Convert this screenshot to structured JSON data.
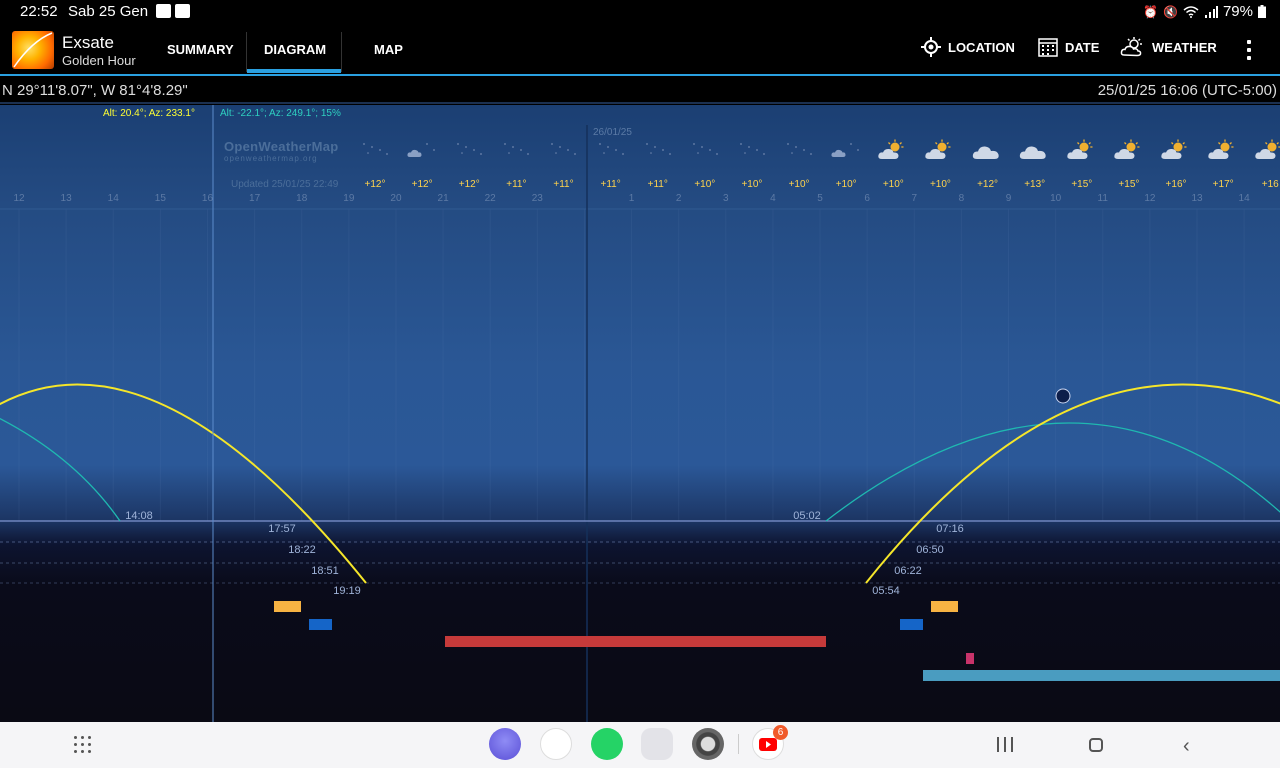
{
  "status_bar": {
    "time": "22:52",
    "date": "Sab 25 Gen",
    "battery": "79%"
  },
  "app": {
    "name": "Exsate",
    "subtitle": "Golden Hour"
  },
  "tabs": [
    {
      "label": "SUMMARY",
      "active": false
    },
    {
      "label": "DIAGRAM",
      "active": true
    },
    {
      "label": "MAP",
      "active": false
    }
  ],
  "actions": {
    "location": "LOCATION",
    "date": "DATE",
    "weather": "WEATHER"
  },
  "coords": {
    "position": "N 29°11'8.07\", W 81°4'8.29\"",
    "datetime": "25/01/25 16:06 (UTC-5:00)"
  },
  "diagram": {
    "sun_readout": "Alt: 20.4°; Az: 233.1°",
    "moon_readout": "Alt: -22.1°; Az: 249.1°; 15%",
    "provider": "OpenWeatherMap",
    "provider_url": "openweathermap.org",
    "updated": "Updated 25/01/25 22:49",
    "next_date": "26/01/25",
    "hours": [
      "12",
      "13",
      "14",
      "15",
      "16",
      "17",
      "18",
      "19",
      "20",
      "21",
      "22",
      "23",
      "",
      "1",
      "2",
      "3",
      "4",
      "5",
      "6",
      "7",
      "8",
      "9",
      "10",
      "11",
      "12",
      "13",
      "14"
    ],
    "temps": [
      "+12°",
      "+12°",
      "+12°",
      "+11°",
      "+11°",
      "+11°",
      "+11°",
      "+10°",
      "+10°",
      "+10°",
      "+10°",
      "+10°",
      "+10°",
      "+12°",
      "+13°",
      "+15°",
      "+15°",
      "+16°",
      "+17°",
      "+16"
    ],
    "weather_icons": [
      "night-clear-icon",
      "night-cloud-icon",
      "night-clear-icon",
      "night-clear-icon",
      "night-clear-icon",
      "night-clear-icon",
      "night-clear-icon",
      "night-clear-icon",
      "night-clear-icon",
      "night-clear-icon",
      "night-cloud-icon",
      "sun-cloud-icon",
      "sun-cloud-icon",
      "cloud-icon",
      "cloud-icon",
      "sun-cloud-icon",
      "sun-cloud-icon",
      "sun-cloud-icon",
      "sun-cloud-icon",
      "sun-cloud-icon"
    ],
    "times": {
      "moonset": "14:08",
      "golden_end": "17:57",
      "sunset_civil": "18:22",
      "nautical": "18:51",
      "astronomical": "19:19",
      "moonrise": "05:02",
      "astro_dawn": "05:54",
      "nautical_dawn": "06:22",
      "civil_dawn": "06:50",
      "sunrise": "07:16"
    },
    "colors": {
      "sun_path": "#f5e62a",
      "moon_path": "#1fb8b0",
      "golden_hour": "#f7b343",
      "blue_hour": "#1565c8",
      "night": "#c63a3a",
      "moon_visible": "#4a9cc0"
    }
  },
  "dock": {
    "youtube_badge": "6"
  }
}
